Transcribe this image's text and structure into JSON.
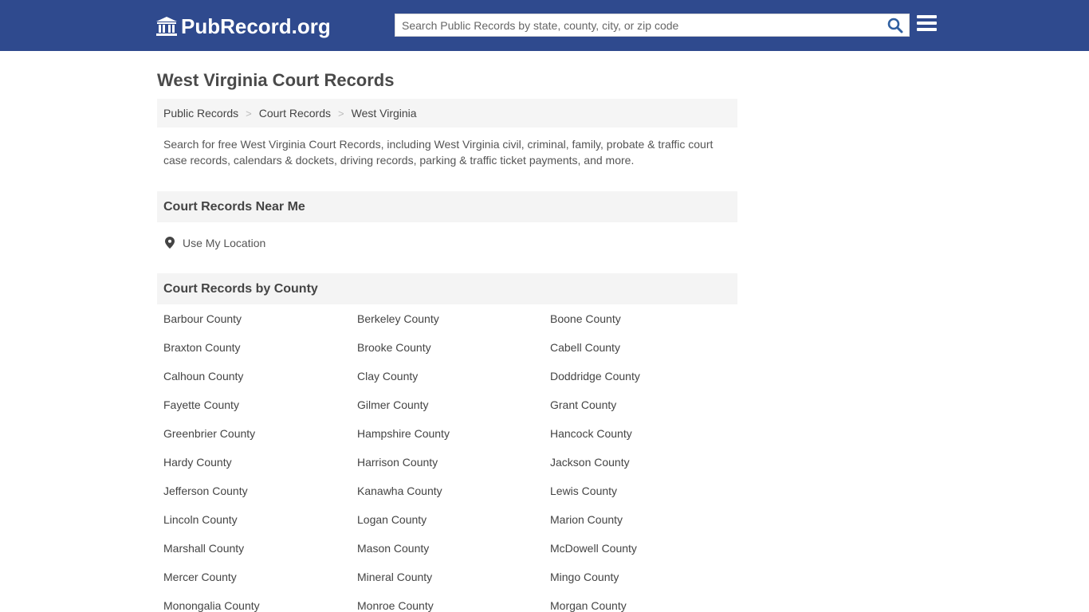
{
  "header": {
    "logo_text": "PubRecord.org",
    "search_placeholder": "Search Public Records by state, county, city, or zip code",
    "brand_color": "#2f4a8e"
  },
  "page": {
    "title": "West Virginia Court Records",
    "breadcrumb": [
      "Public Records",
      "Court Records",
      "West Virginia"
    ],
    "intro": "Search for free West Virginia Court Records, including West Virginia civil, criminal, family, probate & traffic court case records, calendars & dockets, driving records, parking & traffic ticket payments, and more."
  },
  "near_me": {
    "heading": "Court Records Near Me",
    "location_label": "Use My Location"
  },
  "by_county": {
    "heading": "Court Records by County",
    "counties": [
      "Barbour County",
      "Berkeley County",
      "Boone County",
      "Braxton County",
      "Brooke County",
      "Cabell County",
      "Calhoun County",
      "Clay County",
      "Doddridge County",
      "Fayette County",
      "Gilmer County",
      "Grant County",
      "Greenbrier County",
      "Hampshire County",
      "Hancock County",
      "Hardy County",
      "Harrison County",
      "Jackson County",
      "Jefferson County",
      "Kanawha County",
      "Lewis County",
      "Lincoln County",
      "Logan County",
      "Marion County",
      "Marshall County",
      "Mason County",
      "McDowell County",
      "Mercer County",
      "Mineral County",
      "Mingo County",
      "Monongalia County",
      "Monroe County",
      "Morgan County"
    ]
  }
}
